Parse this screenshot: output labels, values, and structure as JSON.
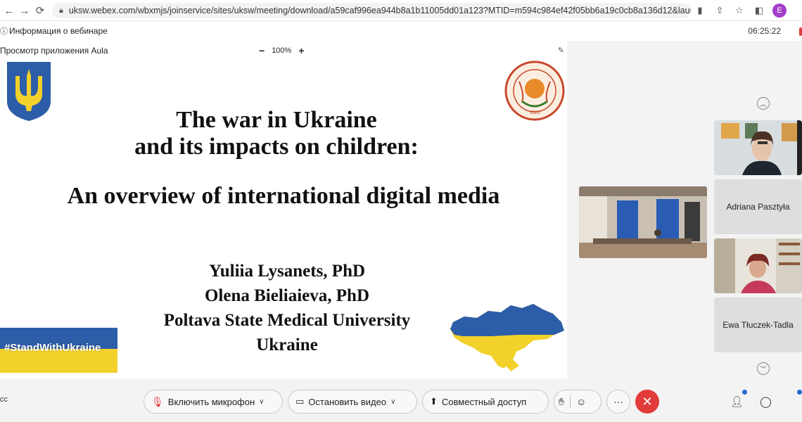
{
  "browser": {
    "url": "uksw.webex.com/wbxmjs/joinservice/sites/uksw/meeting/download/a59caf996ea944b8a1b11005dd01a123?MTID=m594c984ef42f05bb6a19c0cb8a136d12&launc...",
    "back_icon": "arrow-left-icon",
    "forward_icon": "arrow-right-icon",
    "reload_icon": "reload-icon",
    "profile_initial": "E"
  },
  "meeting": {
    "info_label": "Информация о вебинаре",
    "time": "06:25:22",
    "app_view_label": "Просмотр приложения Aula",
    "zoom_level": "100%",
    "zoom_out": "−",
    "zoom_in": "+"
  },
  "slide": {
    "title_line1": "The war in Ukraine",
    "title_line2": "and its impacts on children:",
    "subtitle": "An overview of international digital media",
    "author1": "Yuliia Lysanets, PhD",
    "author2": "Olena Bieliaieva, PhD",
    "affiliation": "Poltava State Medical University",
    "country": "Ukraine",
    "hashtag": "#StandWithUkraine",
    "seal_year": "1921"
  },
  "participants": [
    {
      "name": ""
    },
    {
      "name": "Adriana Pasztyła"
    },
    {
      "name": ""
    },
    {
      "name": "Ewa Tłuczek-Tadla"
    }
  ],
  "controls": {
    "mic_label": "Включить микрофон",
    "video_label": "Остановить видео",
    "share_label": "Совместный доступ",
    "more_label": "···",
    "end_label": "✕"
  },
  "colors": {
    "ukraine_blue": "#2c5da8",
    "ukraine_yellow": "#f2d12a",
    "end_red": "#e23b3b"
  }
}
